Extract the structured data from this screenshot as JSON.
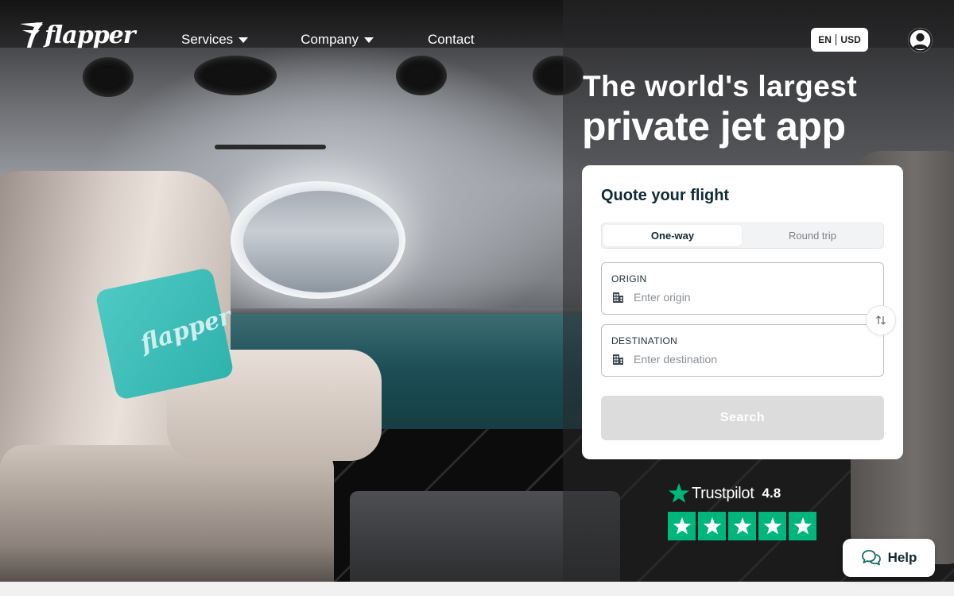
{
  "brand": {
    "logo_text": "flapper",
    "pillow_text": "flapper"
  },
  "nav": {
    "services": "Services",
    "company": "Company",
    "contact": "Contact"
  },
  "locale": {
    "language": "EN",
    "currency": "USD"
  },
  "hero": {
    "headline_line1": "The world's largest",
    "headline_line2": "private jet app"
  },
  "quote": {
    "title": "Quote your flight",
    "trip_types": {
      "one_way": "One-way",
      "round_trip": "Round trip",
      "selected": "One-way"
    },
    "origin": {
      "label": "ORIGIN",
      "placeholder": "Enter origin",
      "value": ""
    },
    "destination": {
      "label": "DESTINATION",
      "placeholder": "Enter destination",
      "value": ""
    },
    "search_label": "Search"
  },
  "trustpilot": {
    "name": "Trustpilot",
    "score": "4.8",
    "stars": 5,
    "color": "#00b67a"
  },
  "help": {
    "label": "Help"
  },
  "icons": {
    "logo": "flapper-wing-icon",
    "dropdown": "caret-down-icon",
    "account": "user-avatar-icon",
    "field": "building-icon",
    "swap": "swap-arrows-icon",
    "help": "chat-bubbles-icon",
    "rating": "star-icon"
  },
  "colors": {
    "accent_teal": "#0f2a36",
    "search_disabled": "#dcdcdc",
    "trustpilot_green": "#00b67a"
  }
}
